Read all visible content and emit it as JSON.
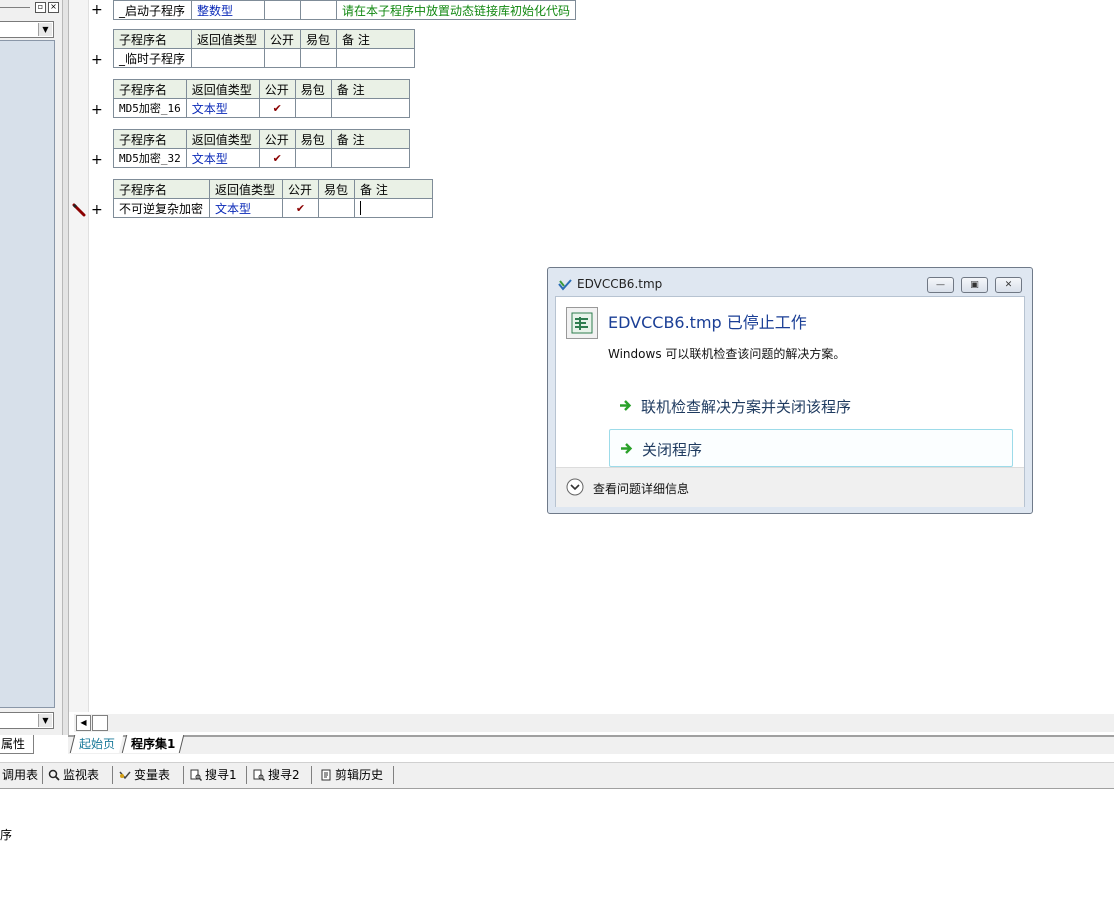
{
  "left_panel": {
    "properties_tab": "属性",
    "bottom_label": "序"
  },
  "editor": {
    "tables": [
      {
        "header": [
          "子程序名",
          "返回值类型",
          "公开",
          "易包",
          "备 注"
        ],
        "row": {
          "name": "_启动子程序",
          "return_type": "整数型",
          "public": "",
          "easy": "",
          "note": "请在本子程序中放置动态链接库初始化代码"
        },
        "show_header": false
      },
      {
        "header": [
          "子程序名",
          "返回值类型",
          "公开",
          "易包",
          "备 注"
        ],
        "row": {
          "name": "_临时子程序",
          "return_type": "",
          "public": "",
          "easy": "",
          "note": ""
        }
      },
      {
        "header": [
          "子程序名",
          "返回值类型",
          "公开",
          "易包",
          "备 注"
        ],
        "row": {
          "name": "MD5加密_16",
          "return_type": "文本型",
          "public": "✔",
          "easy": "",
          "note": ""
        }
      },
      {
        "header": [
          "子程序名",
          "返回值类型",
          "公开",
          "易包",
          "备 注"
        ],
        "row": {
          "name": "MD5加密_32",
          "return_type": "文本型",
          "public": "✔",
          "easy": "",
          "note": ""
        }
      },
      {
        "header": [
          "子程序名",
          "返回值类型",
          "公开",
          "易包",
          "备 注"
        ],
        "row": {
          "name": "不可逆复杂加密",
          "return_type": "文本型",
          "public": "✔",
          "easy": "",
          "note": ""
        }
      }
    ],
    "expand_symbol": "+",
    "tabs": {
      "start": "起始页",
      "program": "程序集1"
    }
  },
  "toolbar": {
    "items": [
      "调用表",
      "监视表",
      "变量表",
      "搜寻1",
      "搜寻2",
      "剪辑历史"
    ]
  },
  "dialog": {
    "window_title": "EDVCCB6.tmp",
    "heading": "EDVCCB6.tmp 已停止工作",
    "description": "Windows 可以联机检查该问题的解决方案。",
    "action_check": "联机检查解决方案并关闭该程序",
    "action_close": "关闭程序",
    "details": "查看问题详细信息"
  },
  "colors": {
    "type_blue": "#0b2ab8",
    "note_green": "#118811",
    "header_bg": "#eaf1e6",
    "dialog_heading": "#1b3f96",
    "arrow_green": "#2aa12a"
  }
}
